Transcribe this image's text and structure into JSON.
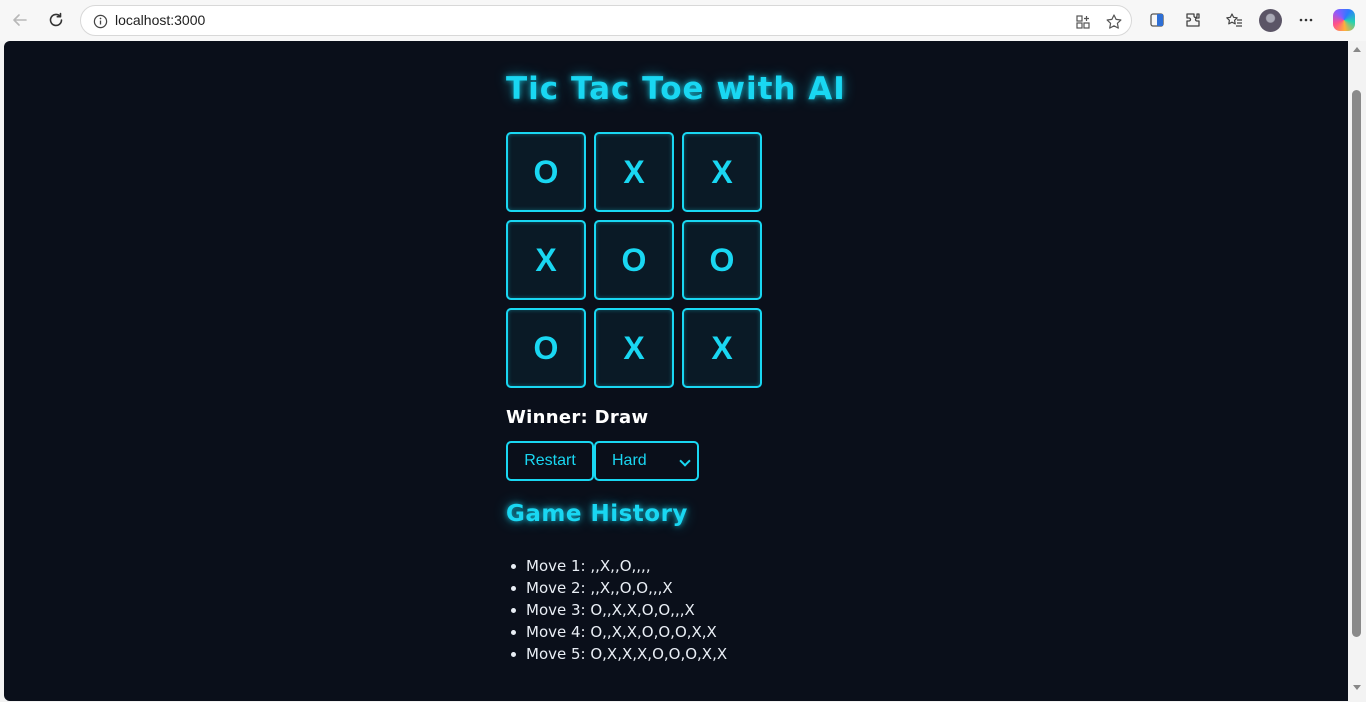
{
  "browser": {
    "url": "localhost:3000"
  },
  "app": {
    "title": "Tic Tac Toe with AI",
    "board": [
      "O",
      "X",
      "X",
      "X",
      "O",
      "O",
      "O",
      "X",
      "X"
    ],
    "status": "Winner: Draw",
    "restart_label": "Restart",
    "difficulty": {
      "selected": "Hard"
    },
    "history_title": "Game History",
    "history": [
      "Move 1: ,,X,,O,,,,",
      "Move 2: ,,X,,O,O,,,X",
      "Move 3: O,,X,X,O,O,,,X",
      "Move 4: O,,X,X,O,O,O,X,X",
      "Move 5: O,X,X,X,O,O,O,X,X"
    ]
  },
  "colors": {
    "accent": "#19d7f2",
    "background": "#0a0f1a"
  }
}
